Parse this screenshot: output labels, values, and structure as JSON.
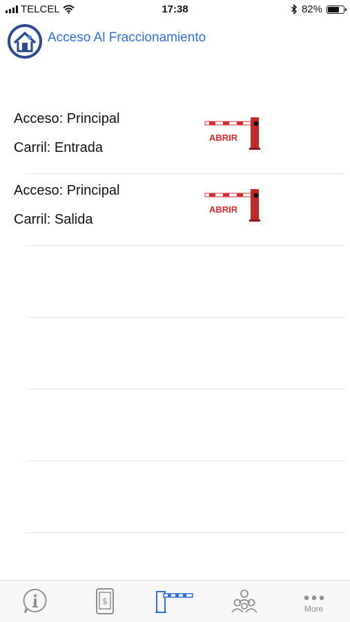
{
  "status_bar": {
    "carrier": "TELCEL",
    "time": "17:38",
    "battery": "82%",
    "battery_level": 0.82
  },
  "header": {
    "title": "Acceso Al Fraccionamiento"
  },
  "rows": [
    {
      "access": "Acceso: Principal",
      "lane": "Carril: Entrada",
      "button_label": "ABRIR"
    },
    {
      "access": "Acceso: Principal",
      "lane": "Carril: Salida",
      "button_label": "ABRIR"
    }
  ],
  "tabbar": {
    "items": [
      {
        "icon": "info-icon"
      },
      {
        "icon": "payment-phone-icon"
      },
      {
        "icon": "barrier-gate-icon",
        "active": true
      },
      {
        "icon": "community-icon"
      },
      {
        "icon": "more-icon",
        "label": "More"
      }
    ]
  },
  "colors": {
    "accent": "#2e6fd8",
    "gate_red": "#d62b2b",
    "inactive": "#8e8e93"
  }
}
